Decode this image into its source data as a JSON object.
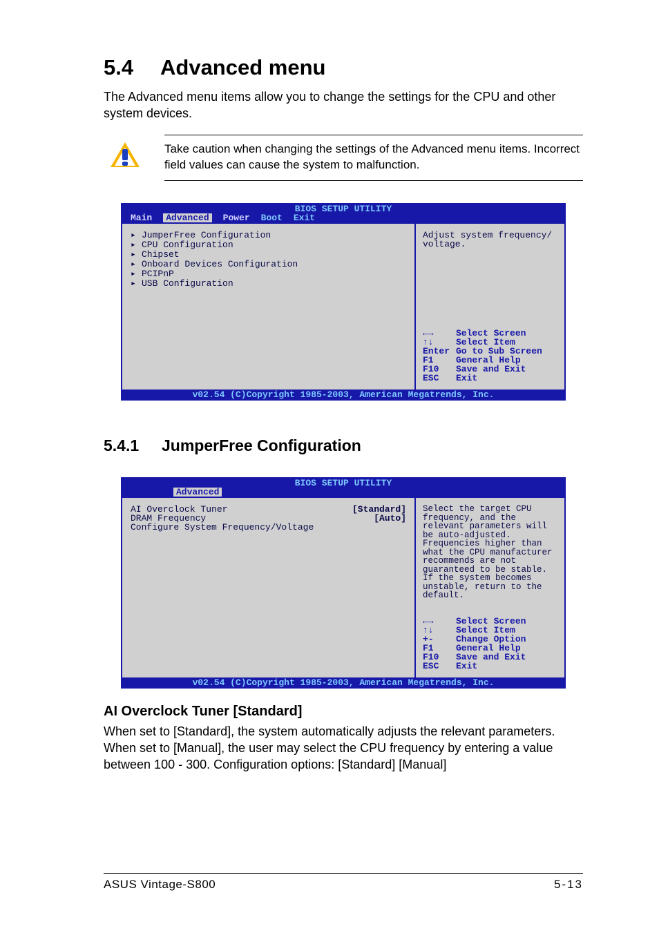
{
  "section": {
    "num": "5.4",
    "title": "Advanced menu"
  },
  "intro": "The Advanced menu items allow you to change the settings for the CPU and other system devices.",
  "caution": "Take caution when changing the settings of the Advanced menu items. Incorrect field values can cause the system to malfunction.",
  "bios_title": "BIOS SETUP UTILITY",
  "copyright": "v02.54 (C)Copyright 1985-2003, American Megatrends, Inc.",
  "bios1": {
    "menu": [
      "Main",
      "Advanced",
      "Power",
      "Boot",
      "Exit"
    ],
    "selected": "Advanced",
    "items": [
      "JumperFree Configuration",
      "CPU Configuration",
      "Chipset",
      "Onboard Devices Configuration",
      "PCIPnP",
      "USB Configuration"
    ],
    "help": "Adjust system frequency/ voltage.",
    "keys": [
      {
        "k": "←→",
        "a": "Select Screen"
      },
      {
        "k": "↑↓",
        "a": "Select Item"
      },
      {
        "k": "Enter",
        "a": "Go to Sub Screen"
      },
      {
        "k": "F1",
        "a": "General Help"
      },
      {
        "k": "F10",
        "a": "Save and Exit"
      },
      {
        "k": "ESC",
        "a": "Exit"
      }
    ]
  },
  "subsection": {
    "num": "5.4.1",
    "title": "JumperFree Configuration"
  },
  "bios2": {
    "selected": "Advanced",
    "fields": [
      {
        "name": "AI Overclock Tuner",
        "value": "[Standard]"
      },
      {
        "name": "DRAM Frequency",
        "value": "[Auto]"
      },
      {
        "name": "Configure System Frequency/Voltage",
        "value": ""
      }
    ],
    "help": "Select the target CPU frequency, and the relevant parameters will be auto-adjusted. Frequencies higher than what the CPU manufacturer recommends are not guaranteed to be stable. If the system becomes unstable, return to the default.",
    "keys": [
      {
        "k": "←→",
        "a": "Select Screen"
      },
      {
        "k": "↑↓",
        "a": "Select Item"
      },
      {
        "k": "+-",
        "a": "Change Option"
      },
      {
        "k": "F1",
        "a": "General Help"
      },
      {
        "k": "F10",
        "a": "Save and Exit"
      },
      {
        "k": "ESC",
        "a": "Exit"
      }
    ]
  },
  "item_heading": "AI Overclock Tuner [Standard]",
  "item_body": "When set to [Standard], the system automatically adjusts the relevant parameters. When set to [Manual], the user may select the CPU frequency by entering a value between 100 - 300. Configuration options: [Standard] [Manual]",
  "footer": {
    "left": "ASUS Vintage-S800",
    "right": "5-13"
  }
}
